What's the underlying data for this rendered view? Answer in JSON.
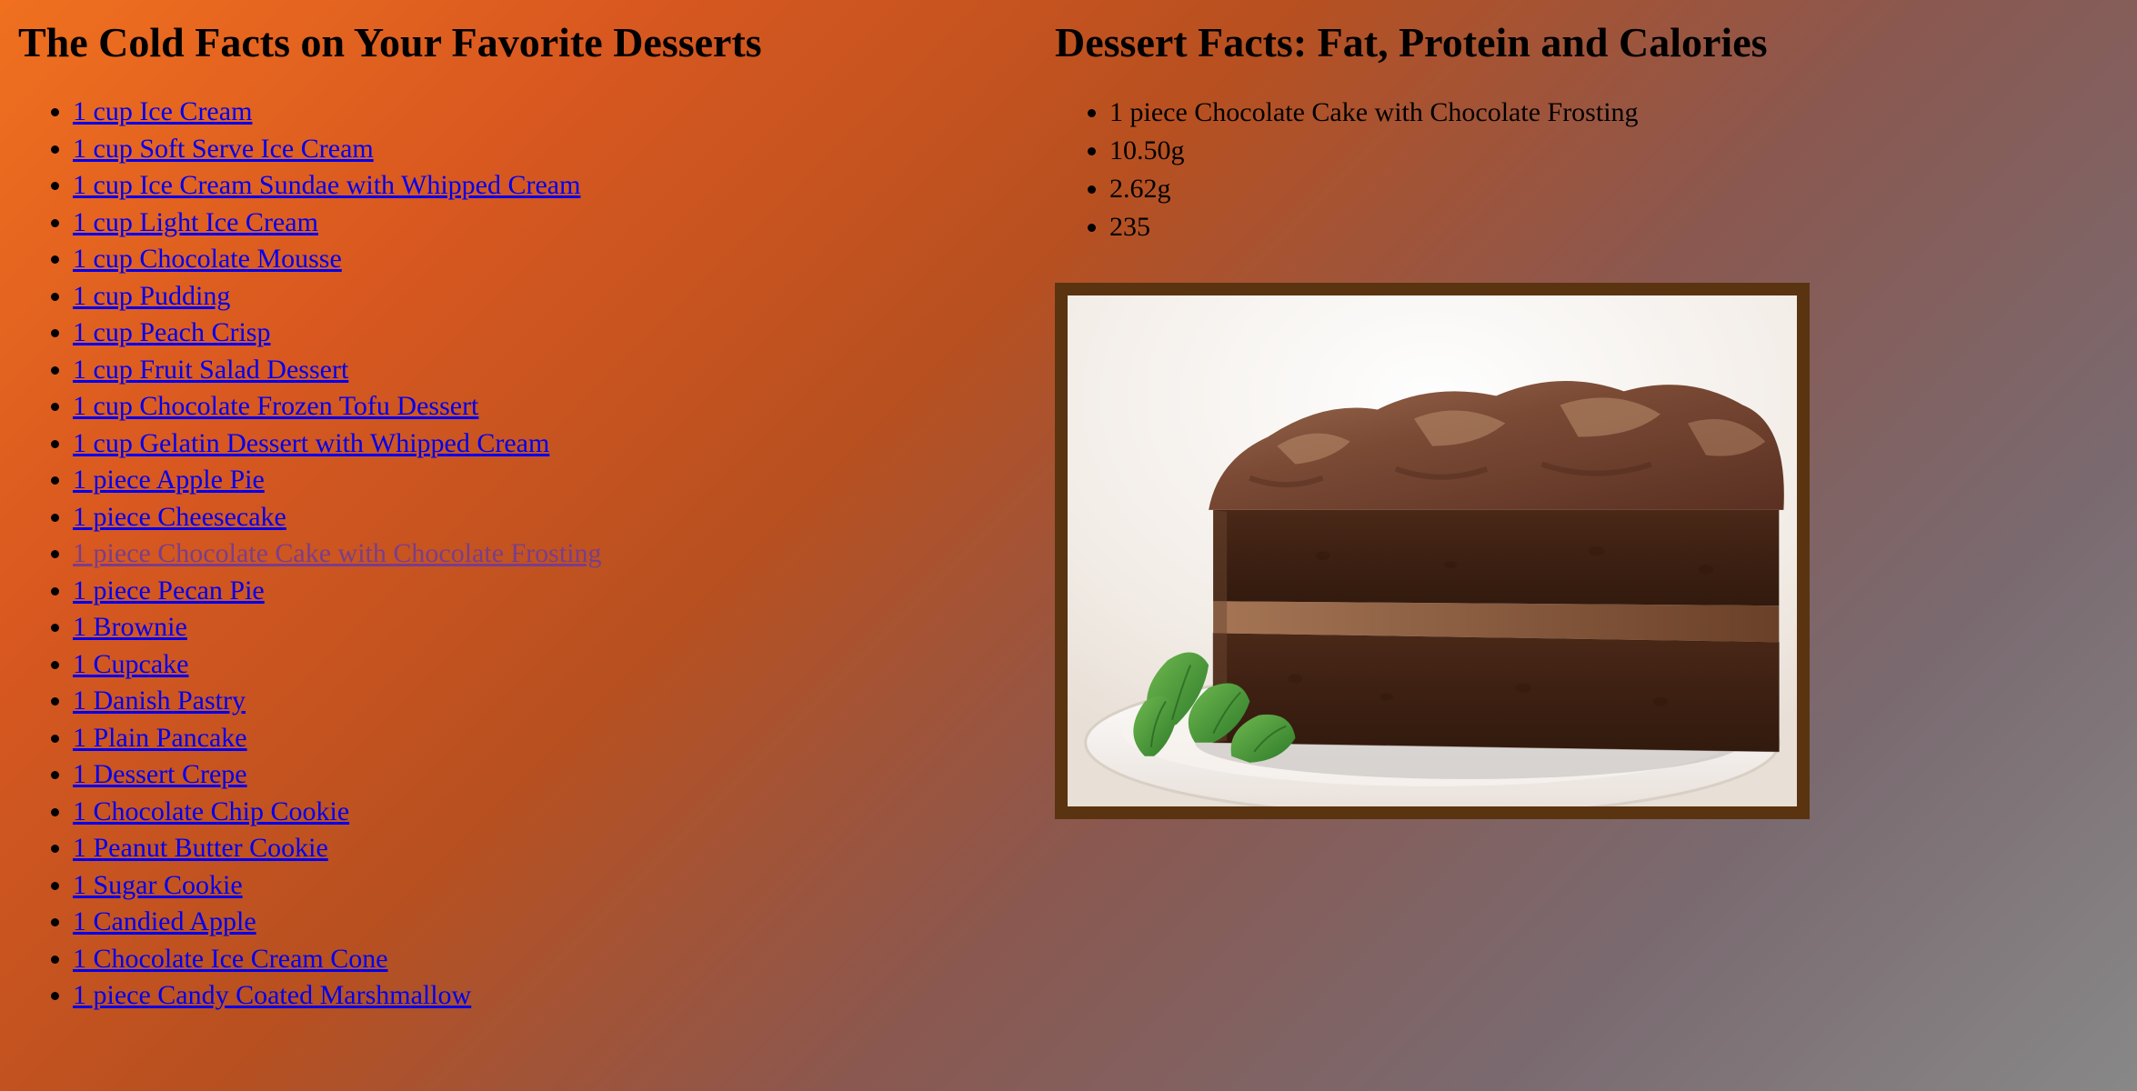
{
  "left": {
    "title": "The Cold Facts on Your Favorite Desserts",
    "links": [
      "1 cup Ice Cream",
      "1 cup Soft Serve Ice Cream",
      "1 cup Ice Cream Sundae with Whipped Cream",
      "1 cup Light Ice Cream",
      "1 cup Chocolate Mousse",
      "1 cup Pudding",
      "1 cup Peach Crisp",
      "1 cup Fruit Salad Dessert",
      "1 cup Chocolate Frozen Tofu Dessert",
      "1 cup Gelatin Dessert with Whipped Cream",
      "1 piece Apple Pie",
      "1 piece Cheesecake",
      "1 piece Chocolate Cake with Chocolate Frosting",
      "1 piece Pecan Pie",
      "1 Brownie",
      "1 Cupcake",
      "1 Danish Pastry",
      "1 Plain Pancake",
      "1 Dessert Crepe",
      "1 Chocolate Chip Cookie",
      "1 Peanut Butter Cookie",
      "1 Sugar Cookie",
      "1 Candied Apple",
      "1 Chocolate Ice Cream Cone",
      "1 piece Candy Coated Marshmallow"
    ],
    "visited_index": 12
  },
  "right": {
    "title": "Dessert Facts: Fat, Protein and Calories",
    "facts": [
      "1 piece Chocolate Cake with Chocolate Frosting",
      "10.50g",
      "2.62g",
      "235"
    ],
    "image_alt": "Chocolate Cake with Chocolate Frosting slice with mint garnish on a plate"
  }
}
